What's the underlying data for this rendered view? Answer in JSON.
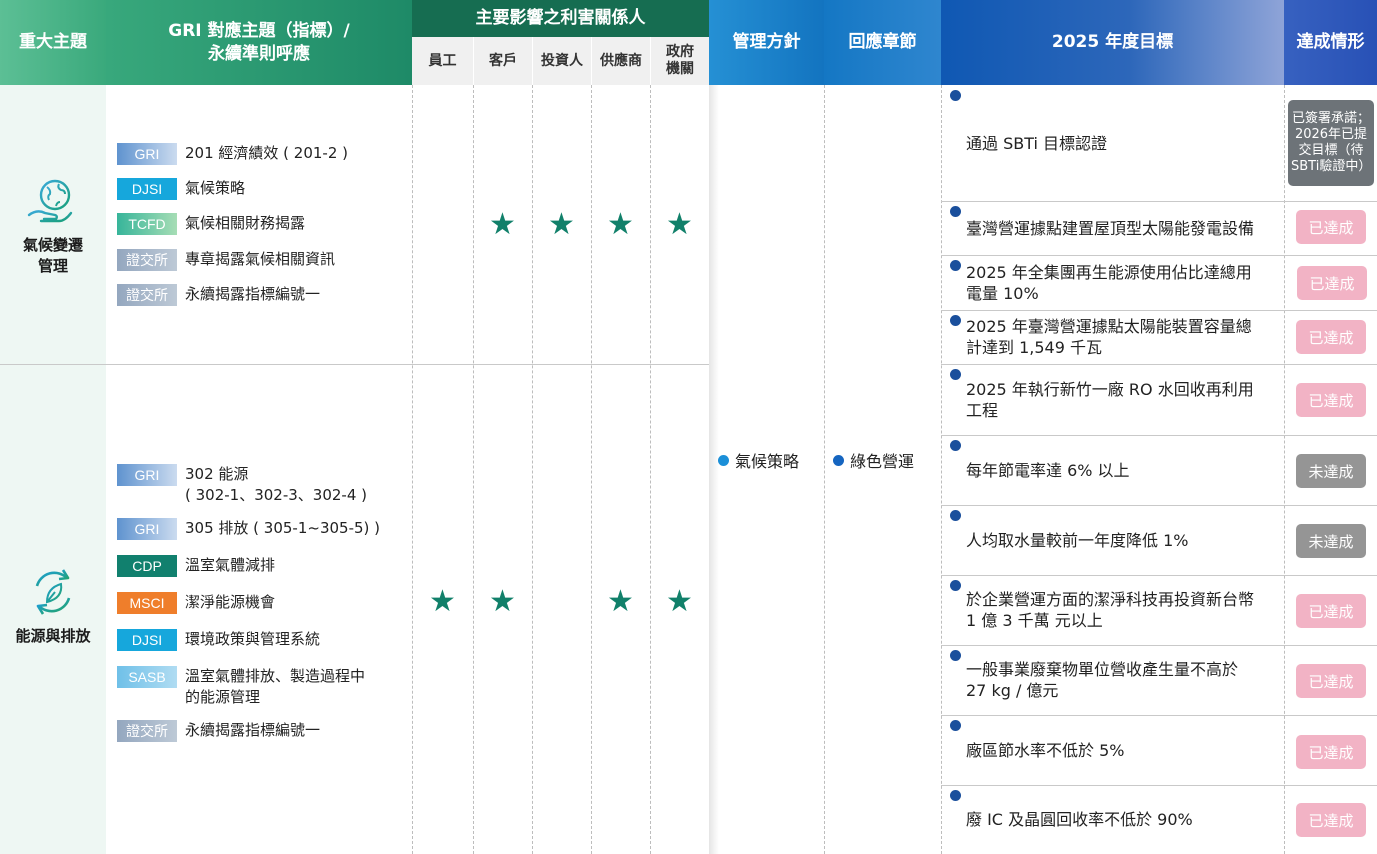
{
  "header": {
    "topic": "重大主題",
    "gri": "GRI 對應主題（指標）/\n永續準則呼應",
    "stakeholders": "主要影響之利害關係人",
    "stakeholder_cols": [
      "員工",
      "客戶",
      "投資人",
      "供應商",
      "政府\n機關"
    ],
    "policy": "管理方針",
    "chapter": "回應章節",
    "target": "2025 年度目標",
    "status": "達成情形"
  },
  "topics": [
    {
      "label": "氣候變遷\n管理",
      "icon": "earth-in-hand-icon",
      "gri": [
        {
          "tag": "GRI",
          "text": "201 經濟績效 ( 201-2 )"
        },
        {
          "tag": "DJSI",
          "text": "氣候策略"
        },
        {
          "tag": "TCFD",
          "text": "氣候相關財務揭露"
        },
        {
          "tag": "證交所",
          "text": "專章揭露氣候相關資訊"
        },
        {
          "tag": "證交所",
          "text": "永續揭露指標編號一"
        }
      ],
      "stakeholders": [
        false,
        true,
        true,
        true,
        true
      ]
    },
    {
      "label": "能源與排放",
      "icon": "recycle-leaf-icon",
      "gri": [
        {
          "tag": "GRI",
          "text": "302 能源\n( 302-1、302-3、302-4 )"
        },
        {
          "tag": "GRI",
          "text": "305 排放 ( 305-1~305-5) )"
        },
        {
          "tag": "CDP",
          "text": "溫室氣體減排"
        },
        {
          "tag": "MSCI",
          "text": "潔淨能源機會"
        },
        {
          "tag": "DJSI",
          "text": "環境政策與管理系統"
        },
        {
          "tag": "SASB",
          "text": "溫室氣體排放、製造過程中\n的能源管理"
        },
        {
          "tag": "證交所",
          "text": "永續揭露指標編號一"
        }
      ],
      "stakeholders": [
        true,
        true,
        false,
        true,
        true
      ]
    }
  ],
  "policy": "氣候策略",
  "chapter": "綠色營運",
  "targets": [
    {
      "text": "通過 SBTi 目標認證",
      "status": "已簽署承諾；\n2026年已提\n交目標（待\nSBTi驗證中）",
      "status_type": "note"
    },
    {
      "text": "臺灣營運據點建置屋頂型太陽能發電設備",
      "status": "已達成",
      "status_type": "done"
    },
    {
      "text": "2025 年全集團再生能源使用佔比達總用\n電量 10%",
      "status": "已達成",
      "status_type": "done"
    },
    {
      "text": "2025 年臺灣營運據點太陽能裝置容量總\n計達到 1,549 千瓦",
      "status": "已達成",
      "status_type": "done"
    },
    {
      "text": "2025 年執行新竹一廠 RO 水回收再利用\n工程",
      "status": "已達成",
      "status_type": "done"
    },
    {
      "text": "每年節電率達 6% 以上",
      "status": "未達成",
      "status_type": "miss"
    },
    {
      "text": "人均取水量較前一年度降低 1%",
      "status": "未達成",
      "status_type": "miss"
    },
    {
      "text": "於企業營運方面的潔淨科技再投資新台幣\n1 億 3 千萬 元以上",
      "status": "已達成",
      "status_type": "done"
    },
    {
      "text": "一般事業廢棄物單位營收產生量不高於\n27 kg / 億元",
      "status": "已達成",
      "status_type": "done"
    },
    {
      "text": "廠區節水率不低於 5%",
      "status": "已達成",
      "status_type": "done"
    },
    {
      "text": "廢 IC 及晶圓回收率不低於 90%",
      "status": "已達成",
      "status_type": "done"
    }
  ],
  "colors": {
    "star": "#11806a",
    "bullet": "#1a4f9c",
    "done": "#f2b3c5",
    "miss": "#959595"
  }
}
